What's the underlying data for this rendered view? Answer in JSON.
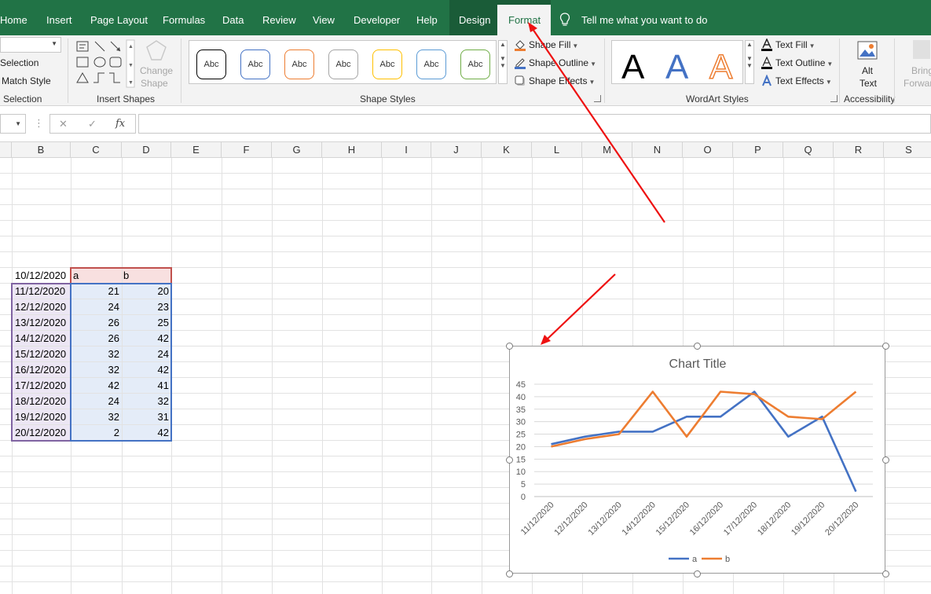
{
  "tabs": [
    "Home",
    "Insert",
    "Page Layout",
    "Formulas",
    "Data",
    "Review",
    "View",
    "Developer",
    "Help",
    "Design",
    "Format"
  ],
  "active_tab": "Format",
  "tell_me": "Tell me what you want to do",
  "ribbon": {
    "selection_group": {
      "items": [
        "Selection",
        "Match Style"
      ],
      "label": "Selection"
    },
    "insert_shapes": {
      "label": "Insert Shapes",
      "change_shape": [
        "Change",
        "Shape"
      ]
    },
    "shape_styles": {
      "label": "Shape Styles",
      "preset_text": "Abc",
      "preset_colors": [
        "#000000",
        "#4472c4",
        "#ed7d31",
        "#a5a5a5",
        "#ffc000",
        "#5b9bd5",
        "#70ad47"
      ],
      "fill": "Shape Fill",
      "outline": "Shape Outline",
      "effects": "Shape Effects"
    },
    "wordart_styles": {
      "label": "WordArt Styles",
      "letter": "A",
      "text_fill": "Text Fill",
      "text_outline": "Text Outline",
      "text_effects": "Text Effects"
    },
    "accessibility": {
      "label": "Accessibility",
      "alt_text": [
        "Alt",
        "Text"
      ],
      "bring_forward": [
        "Bring",
        "Forward"
      ]
    }
  },
  "formula_bar": {
    "cancel": "✕",
    "enter": "✓",
    "fx": "fx",
    "value": ""
  },
  "columns": [
    "B",
    "C",
    "D",
    "E",
    "F",
    "G",
    "H",
    "I",
    "J",
    "K",
    "L",
    "M",
    "N",
    "O",
    "P",
    "Q",
    "R",
    "S"
  ],
  "table": {
    "header": [
      "10/12/2020",
      "a",
      "b"
    ],
    "rows": [
      [
        "11/12/2020",
        "21",
        "20"
      ],
      [
        "12/12/2020",
        "24",
        "23"
      ],
      [
        "13/12/2020",
        "26",
        "25"
      ],
      [
        "14/12/2020",
        "26",
        "42"
      ],
      [
        "15/12/2020",
        "32",
        "24"
      ],
      [
        "16/12/2020",
        "32",
        "42"
      ],
      [
        "17/12/2020",
        "42",
        "41"
      ],
      [
        "18/12/2020",
        "24",
        "32"
      ],
      [
        "19/12/2020",
        "32",
        "31"
      ],
      [
        "20/12/2020",
        "2",
        "42"
      ]
    ]
  },
  "chart_data": {
    "type": "line",
    "title": "Chart Title",
    "categories": [
      "11/12/2020",
      "12/12/2020",
      "13/12/2020",
      "14/12/2020",
      "15/12/2020",
      "16/12/2020",
      "17/12/2020",
      "18/12/2020",
      "19/12/2020",
      "20/12/2020"
    ],
    "series": [
      {
        "name": "a",
        "values": [
          21,
          24,
          26,
          26,
          32,
          32,
          42,
          24,
          32,
          2
        ],
        "color": "#4472c4"
      },
      {
        "name": "b",
        "values": [
          20,
          23,
          25,
          42,
          24,
          42,
          41,
          32,
          31,
          42
        ],
        "color": "#ed7d31"
      }
    ],
    "ylim": [
      0,
      45
    ],
    "yticks": [
      0,
      5,
      10,
      15,
      20,
      25,
      30,
      35,
      40,
      45
    ],
    "grid": true,
    "legend": "bottom"
  },
  "colors": {
    "ribbon_green": "#217346",
    "annotation_arrow": "#ee1111"
  }
}
